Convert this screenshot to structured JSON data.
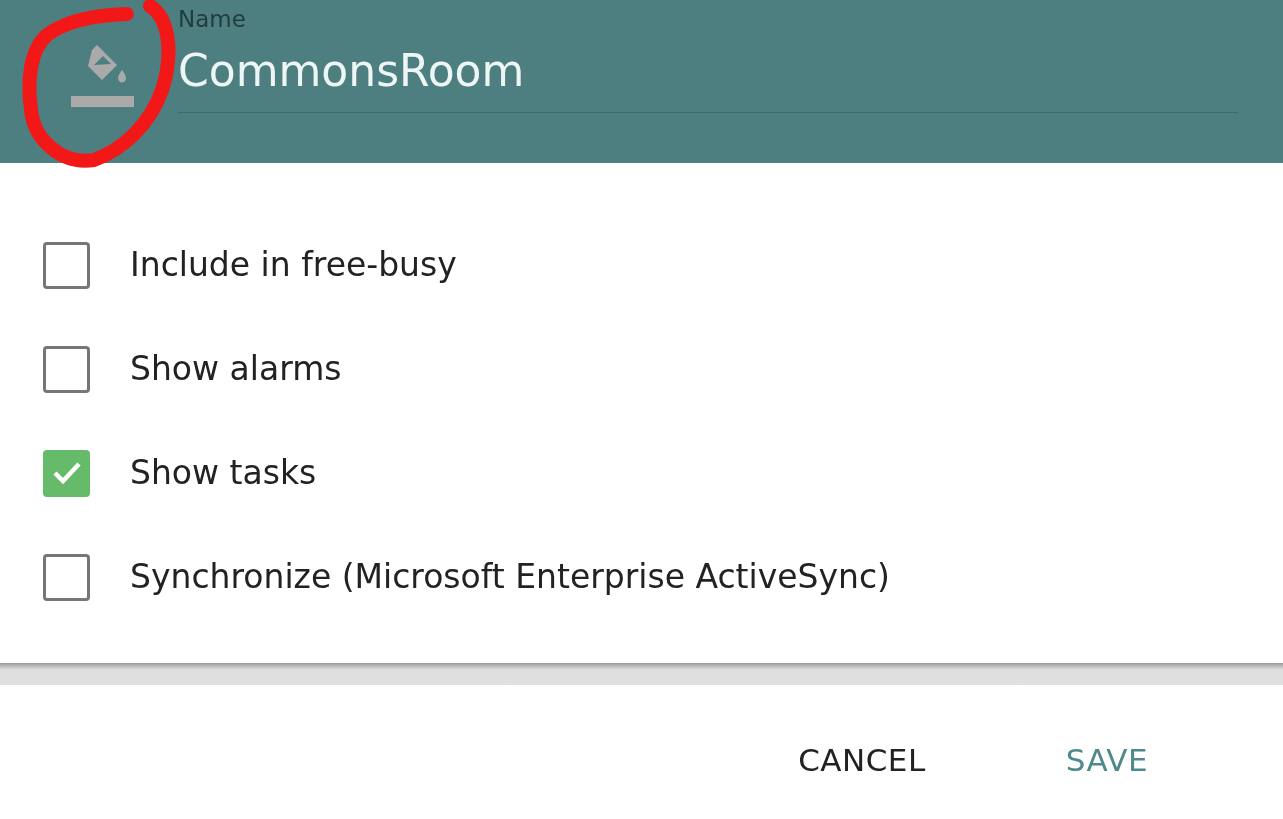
{
  "name_field": {
    "label": "Name",
    "value": "CommonsRoom"
  },
  "options": [
    {
      "label": "Include in free-busy",
      "checked": false
    },
    {
      "label": "Show alarms",
      "checked": false
    },
    {
      "label": "Show tasks",
      "checked": true
    },
    {
      "label": "Synchronize (Microsoft Enterprise ActiveSync)",
      "checked": false
    }
  ],
  "buttons": [
    {
      "label": "CANCEL",
      "kind": "secondary"
    },
    {
      "label": "SAVE",
      "kind": "primary"
    }
  ]
}
